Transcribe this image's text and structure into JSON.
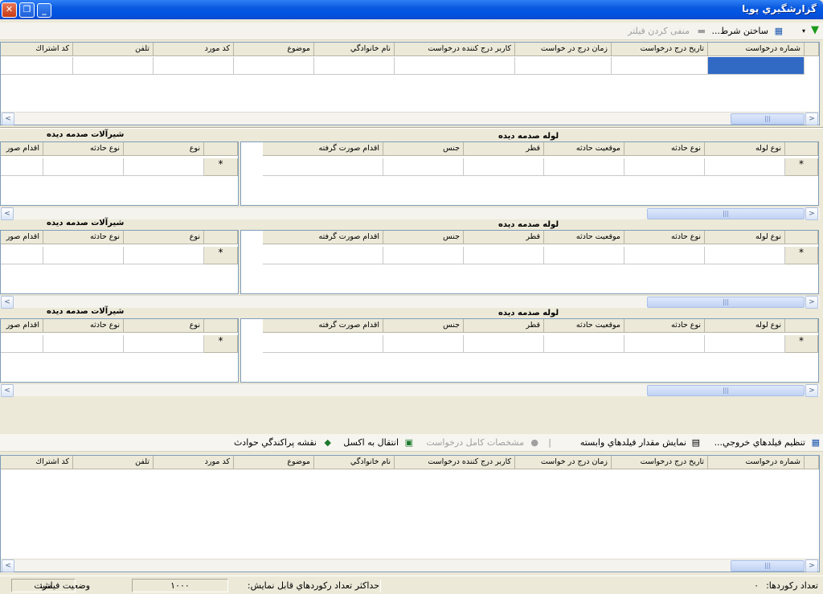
{
  "window": {
    "title": "گزارشگيري پويا"
  },
  "top_toolbar": {
    "filter_label": "ساختن شرط...",
    "negate_label": "منفی کردن فیلتر"
  },
  "request_columns": [
    "شماره درخواست",
    "تاريخ درج درخواست",
    "زمان درج در خواست",
    "كاربر درج كننده درخواست",
    "نام خانوادگي",
    "موضوع",
    "كد مورد",
    "تلفن",
    "كد اشتراك"
  ],
  "detail_panels": [
    {
      "pipe_title": "لوله صدمه ديده",
      "valve_title": "شيرآلات صدمه ديده"
    },
    {
      "pipe_title": "لوله صدمه ديده",
      "valve_title": "شيرآلات صدمه ديده"
    },
    {
      "pipe_title": "لوله صدمه ديده",
      "valve_title": "شيرآلات صدمه ديده"
    }
  ],
  "pipe_columns": [
    "نوع لوله",
    "نوع حادثه",
    "موقعيت حادثه",
    "قطر",
    "جنس",
    "اقدام صورت گرفته"
  ],
  "valve_columns": [
    "نوع",
    "نوع حادثه",
    "اقدام صور"
  ],
  "new_row_marker": "*",
  "bottom_toolbar": {
    "output_fields": "تنظيم فيلدهاي خروجي...",
    "show_dependent": "نمايش مقدار فيلدهاي وابسته",
    "full_details": "مشخصات کامل درخواست",
    "export_excel": "انتقال به اکسل",
    "incident_map": "نقشه پراکندگي حوادث"
  },
  "status_bar": {
    "record_count_label": "تعداد رکوردها:",
    "record_count_value": "۰",
    "max_records_label": "حداکثر تعداد رکوردهاي قابل نمايش:",
    "max_records_value": "۱۰۰۰",
    "filter_state_label": "وضعيت فيلتر:",
    "filter_state_value": "مثبت"
  },
  "colors": {
    "title_blue": "#0054e3",
    "selection": "#316ac5",
    "chrome": "#ece9d8"
  }
}
